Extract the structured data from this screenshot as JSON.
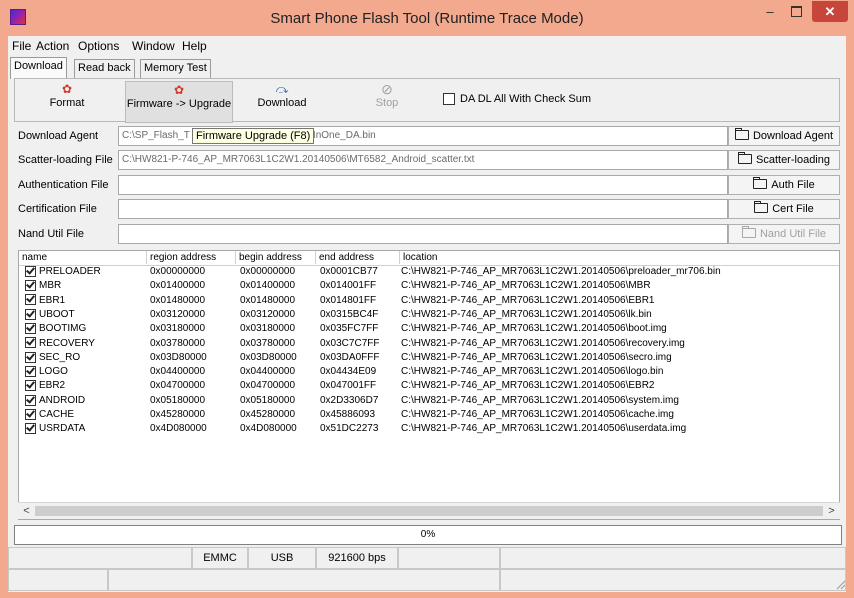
{
  "window": {
    "title": "Smart Phone Flash Tool (Runtime Trace Mode)",
    "minimize": "–",
    "close": "✕"
  },
  "menu": [
    "File",
    "Action",
    "Options",
    "Window",
    "Help"
  ],
  "tabs": [
    "Download",
    "Read back",
    "Memory Test"
  ],
  "toolbar": {
    "format": {
      "label": "Format",
      "icon": "format-icon"
    },
    "firmware_upgrade": {
      "label": "Firmware -> Upgrade",
      "icon": "firmware-upgrade-icon"
    },
    "download": {
      "label": "Download",
      "icon": "download-icon"
    },
    "stop": {
      "label": "Stop",
      "icon": "stop-icon"
    },
    "checksum": {
      "label": "DA DL All With Check Sum",
      "checked": false
    }
  },
  "tooltip": "Firmware Upgrade (F8)",
  "files": {
    "download_agent": {
      "label": "Download Agent",
      "value_prefix": "C:\\SP_Flash_T",
      "value_suffix": "AllInOne_DA.bin",
      "button": "Download Agent"
    },
    "scatter": {
      "label": "Scatter-loading File",
      "value": "C:\\HW821-P-746_AP_MR7063L1C2W1.20140506\\MT6582_Android_scatter.txt",
      "button": "Scatter-loading"
    },
    "auth": {
      "label": "Authentication File",
      "value": "",
      "button": "Auth File"
    },
    "cert": {
      "label": "Certification File",
      "value": "",
      "button": "Cert File"
    },
    "nand": {
      "label": "Nand Util File",
      "value": "",
      "button": "Nand Util File"
    }
  },
  "table": {
    "headers": [
      "name",
      "region address",
      "begin address",
      "end address",
      "location"
    ],
    "rows": [
      {
        "name": "PRELOADER",
        "region": "0x00000000",
        "begin": "0x00000000",
        "end": "0x0001CB77",
        "location": "C:\\HW821-P-746_AP_MR7063L1C2W1.20140506\\preloader_mr706.bin",
        "checked": true
      },
      {
        "name": "MBR",
        "region": "0x01400000",
        "begin": "0x01400000",
        "end": "0x014001FF",
        "location": "C:\\HW821-P-746_AP_MR7063L1C2W1.20140506\\MBR",
        "checked": true
      },
      {
        "name": "EBR1",
        "region": "0x01480000",
        "begin": "0x01480000",
        "end": "0x014801FF",
        "location": "C:\\HW821-P-746_AP_MR7063L1C2W1.20140506\\EBR1",
        "checked": true
      },
      {
        "name": "UBOOT",
        "region": "0x03120000",
        "begin": "0x03120000",
        "end": "0x0315BC4F",
        "location": "C:\\HW821-P-746_AP_MR7063L1C2W1.20140506\\lk.bin",
        "checked": true
      },
      {
        "name": "BOOTIMG",
        "region": "0x03180000",
        "begin": "0x03180000",
        "end": "0x035FC7FF",
        "location": "C:\\HW821-P-746_AP_MR7063L1C2W1.20140506\\boot.img",
        "checked": true
      },
      {
        "name": "RECOVERY",
        "region": "0x03780000",
        "begin": "0x03780000",
        "end": "0x03C7C7FF",
        "location": "C:\\HW821-P-746_AP_MR7063L1C2W1.20140506\\recovery.img",
        "checked": true
      },
      {
        "name": "SEC_RO",
        "region": "0x03D80000",
        "begin": "0x03D80000",
        "end": "0x03DA0FFF",
        "location": "C:\\HW821-P-746_AP_MR7063L1C2W1.20140506\\secro.img",
        "checked": true
      },
      {
        "name": "LOGO",
        "region": "0x04400000",
        "begin": "0x04400000",
        "end": "0x04434E09",
        "location": "C:\\HW821-P-746_AP_MR7063L1C2W1.20140506\\logo.bin",
        "checked": true
      },
      {
        "name": "EBR2",
        "region": "0x04700000",
        "begin": "0x04700000",
        "end": "0x047001FF",
        "location": "C:\\HW821-P-746_AP_MR7063L1C2W1.20140506\\EBR2",
        "checked": true
      },
      {
        "name": "ANDROID",
        "region": "0x05180000",
        "begin": "0x05180000",
        "end": "0x2D3306D7",
        "location": "C:\\HW821-P-746_AP_MR7063L1C2W1.20140506\\system.img",
        "checked": true
      },
      {
        "name": "CACHE",
        "region": "0x45280000",
        "begin": "0x45280000",
        "end": "0x45886093",
        "location": "C:\\HW821-P-746_AP_MR7063L1C2W1.20140506\\cache.img",
        "checked": true
      },
      {
        "name": "USRDATA",
        "region": "0x4D080000",
        "begin": "0x4D080000",
        "end": "0x51DC2273",
        "location": "C:\\HW821-P-746_AP_MR7063L1C2W1.20140506\\userdata.img",
        "checked": true
      }
    ]
  },
  "progress": {
    "text": "0%",
    "value": 0,
    "color": "#3ea5e0"
  },
  "status": {
    "storage": "EMMC",
    "connection": "USB",
    "baud": "921600 bps"
  },
  "colors": {
    "titlebar": "#f3a98e",
    "close": "#c7453a"
  }
}
